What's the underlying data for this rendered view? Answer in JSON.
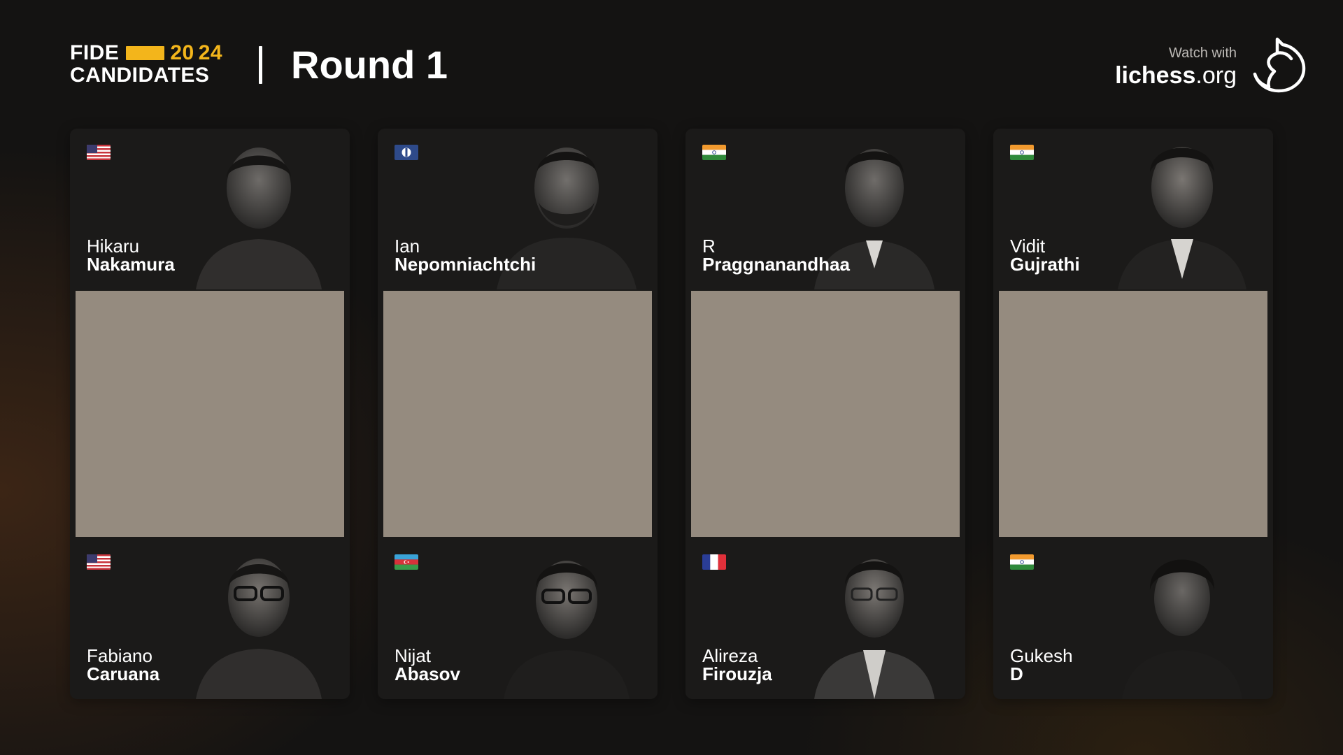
{
  "header": {
    "logo_line1_word": "FIDE",
    "logo_year_part1": "20",
    "logo_year_part2": "24",
    "logo_line2": "CANDIDATES",
    "round_title": "Round 1",
    "watch_with": "Watch with",
    "lichess_bold": "lichess",
    "lichess_suffix": ".org",
    "brand_logo_icon": "lichess-knight-icon",
    "accent_color": "#f3b51b"
  },
  "games": [
    {
      "white": {
        "first": "Hikaru",
        "last": "Nakamura",
        "flag": "flag-usa-icon"
      },
      "black": {
        "first": "Fabiano",
        "last": "Caruana",
        "flag": "flag-usa-icon"
      }
    },
    {
      "white": {
        "first": "Ian",
        "last": "Nepomniachtchi",
        "flag": "flag-fide-icon"
      },
      "black": {
        "first": "Nijat",
        "last": "Abasov",
        "flag": "flag-azerbaijan-icon"
      }
    },
    {
      "white": {
        "first": "R",
        "last": "Praggnanandhaa",
        "flag": "flag-india-icon"
      },
      "black": {
        "first": "Alireza",
        "last": "Firouzja",
        "flag": "flag-france-icon"
      }
    },
    {
      "white": {
        "first": "Vidit",
        "last": "Gujrathi",
        "flag": "flag-india-icon"
      },
      "black": {
        "first": "Gukesh",
        "last": "D",
        "flag": "flag-india-icon"
      }
    }
  ],
  "colors": {
    "background": "#141312",
    "card": "#1b1a19",
    "board_placeholder": "#958b7f"
  }
}
